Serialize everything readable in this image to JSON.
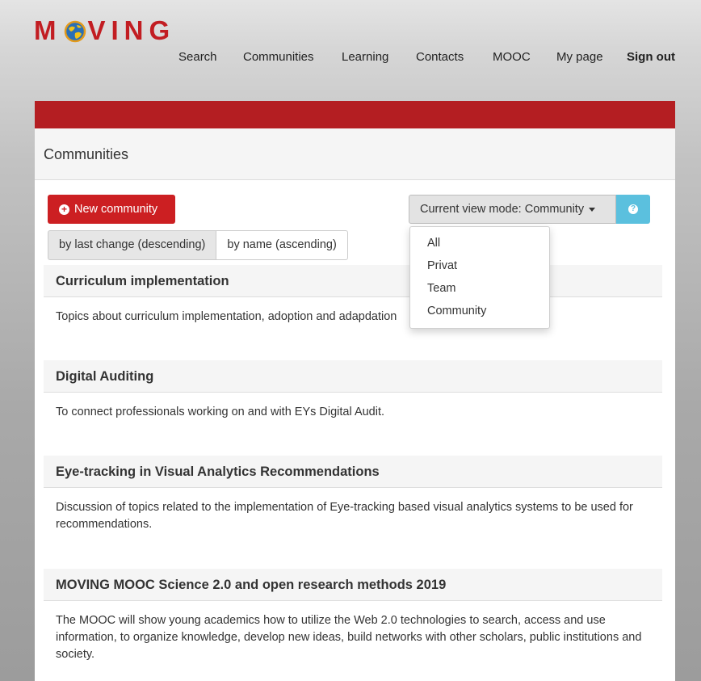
{
  "logo": {
    "text_left": "M",
    "text_right": "VING"
  },
  "nav": {
    "items": [
      "Search",
      "Communities",
      "Learning",
      "Contacts",
      "MOOC",
      "My page"
    ],
    "signout": "Sign out"
  },
  "panel": {
    "heading": "Communities"
  },
  "toolbar": {
    "new_community": "New community",
    "view_mode": "Current view mode: Community",
    "sort_last_change": "by last change (descending)",
    "sort_name": "by name (ascending)"
  },
  "view_mode_options": [
    "All",
    "Privat",
    "Team",
    "Community"
  ],
  "communities": [
    {
      "title": "Curriculum implementation",
      "description": "Topics about curriculum implementation, adoption and adapdation"
    },
    {
      "title": "Digital Auditing",
      "description": "To connect professionals working on and with EYs Digital Audit."
    },
    {
      "title": "Eye-tracking in Visual Analytics Recommendations",
      "description": "Discussion of topics related to the implementation of Eye-tracking based visual analytics systems to be used for recommendations."
    },
    {
      "title": "MOVING MOOC Science 2.0 and open research methods 2019",
      "description": "The MOOC will show young academics how to utilize the Web 2.0 technologies to search, access and use information, to organize knowledge, develop new ideas, build networks with other scholars, public institutions and society."
    }
  ],
  "colors": {
    "brand_red": "#c21d22",
    "banner_red": "#b41e22",
    "button_red": "#cc1f22",
    "info_blue": "#5bc0de"
  },
  "icons": [
    "globe-icon",
    "plus-circle-icon",
    "caret-down-icon",
    "question-circle-icon"
  ]
}
